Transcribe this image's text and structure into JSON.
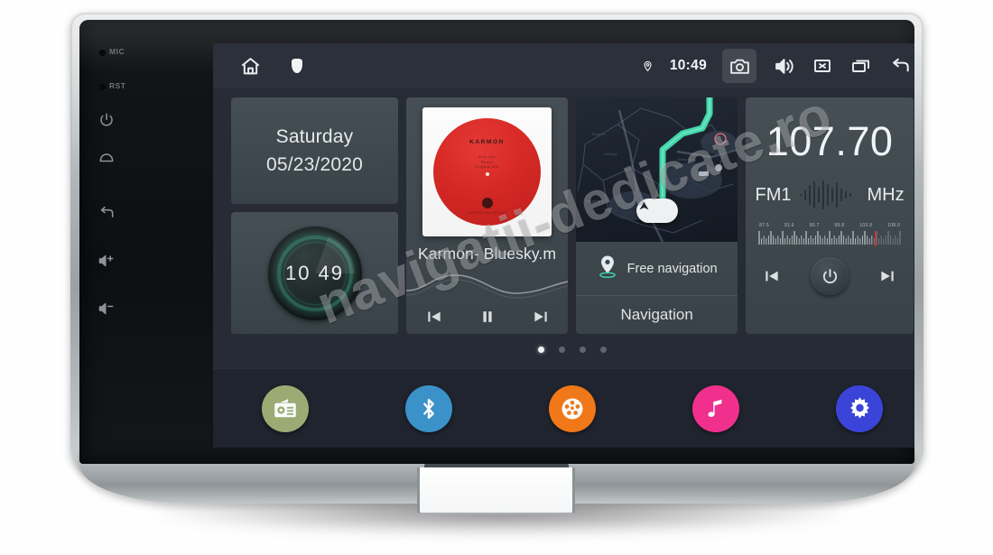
{
  "device": {
    "bezel_buttons": [
      {
        "name": "mic-indicator",
        "label": "MIC"
      },
      {
        "name": "reset-indicator",
        "label": "RST"
      },
      {
        "name": "power-button",
        "label": ""
      },
      {
        "name": "home-button",
        "label": ""
      },
      {
        "name": "back-button",
        "label": ""
      },
      {
        "name": "volume-up-button",
        "label": ""
      },
      {
        "name": "volume-down-button",
        "label": ""
      }
    ]
  },
  "statusbar": {
    "home_icon": "home-icon",
    "shield_icon": "shield-icon",
    "location_icon": "location-pin-icon",
    "time": "10:49",
    "screenshot_icon": "camera-icon",
    "volume_icon": "speaker-icon",
    "mute_icon": "mute-x-icon",
    "recents_icon": "recents-icon",
    "back_icon": "back-arrow-icon"
  },
  "widgets": {
    "date": {
      "day": "Saturday",
      "date": "05/23/2020"
    },
    "clock": {
      "time": "10 49",
      "ring_color": "#349678"
    },
    "music": {
      "album_brand": "KARMON",
      "album_lines": "Blue Sky\nRemix\nOriginal Mix",
      "album_foot": "KARMON RECORDINGS",
      "track_title": "Karmon- Bluesky.m",
      "prev_icon": "previous-track-icon",
      "pause_icon": "pause-icon",
      "next_icon": "next-track-icon",
      "album_color": "#d9231f"
    },
    "navigation": {
      "free_nav_label": "Free navigation",
      "pin_icon": "map-pin-icon",
      "title": "Navigation",
      "route_color": "#3fe0b0",
      "marker_icon": "navigation-arrow-icon"
    },
    "radio": {
      "frequency": "107.70",
      "band": "FM1",
      "unit": "MHz",
      "scale_labels": [
        "87.5",
        "91.6",
        "95.7",
        "99.8",
        "103.9",
        "108.0"
      ],
      "prev_icon": "previous-station-icon",
      "power_icon": "power-icon",
      "next_icon": "next-station-icon"
    }
  },
  "pager": {
    "total": 4,
    "active": 1
  },
  "dock": [
    {
      "name": "dock-radio",
      "label": "Radio",
      "icon": "radio-icon",
      "color": "#9aab74"
    },
    {
      "name": "dock-bluetooth",
      "label": "Bluetooth",
      "icon": "bluetooth-icon",
      "color": "#3b92c9"
    },
    {
      "name": "dock-video",
      "label": "Video",
      "icon": "film-reel-icon",
      "color": "#f07818"
    },
    {
      "name": "dock-music",
      "label": "Music",
      "icon": "music-note-icon",
      "color": "#f0308c"
    },
    {
      "name": "dock-settings",
      "label": "Settings",
      "icon": "gear-icon",
      "color": "#3b44d9"
    }
  ],
  "watermark": {
    "text": "navigatii-dedicate.ro"
  }
}
